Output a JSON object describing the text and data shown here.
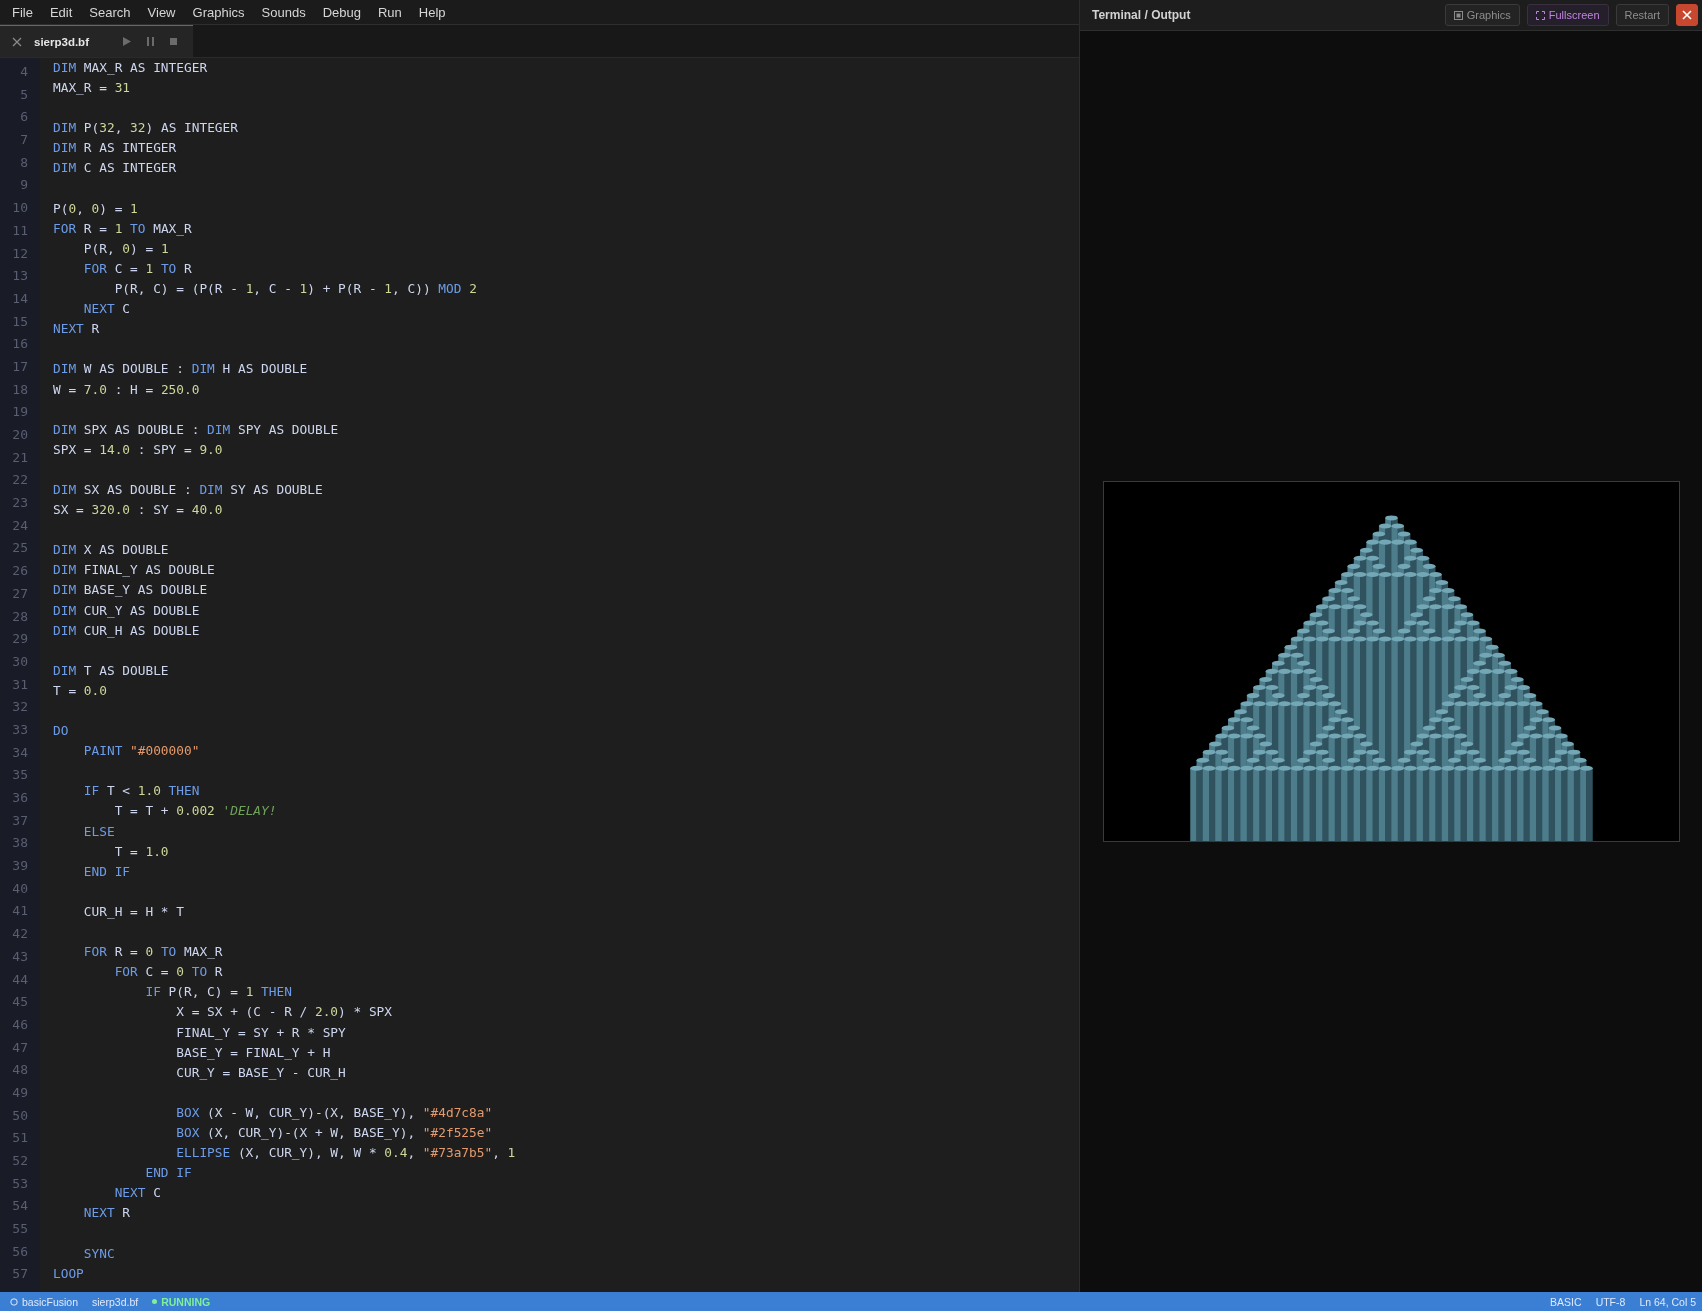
{
  "menu": [
    "File",
    "Edit",
    "Search",
    "View",
    "Graphics",
    "Sounds",
    "Debug",
    "Run",
    "Help"
  ],
  "tabs": [
    {
      "title": "sierp3d.bf",
      "selected": true
    }
  ],
  "line_numbers": [
    "4",
    "5",
    "6",
    "7",
    "8",
    "9",
    "10",
    "11",
    "12",
    "13",
    "14",
    "15",
    "16",
    "17",
    "18",
    "19",
    "20",
    "21",
    "22",
    "23",
    "24",
    "25",
    "26",
    "27",
    "28",
    "29",
    "30",
    "31",
    "32",
    "33",
    "34",
    "35",
    "36",
    "37",
    "38",
    "39",
    "40",
    "41",
    "42",
    "43",
    "44",
    "45",
    "46",
    "47",
    "48",
    "49",
    "50",
    "51",
    "52",
    "53",
    "54",
    "55",
    "56",
    "57"
  ],
  "code_blocks": [
    [
      [
        {
          "kind": "kw",
          "text": "DIM"
        },
        {
          "kind": "id",
          "text": " MAX_R AS INTEGER"
        }
      ],
      [
        {
          "kind": "id",
          "text": "MAX_R = "
        },
        {
          "kind": "num",
          "text": "31"
        }
      ]
    ],
    [
      [
        {
          "kind": "kw",
          "text": "DIM"
        },
        {
          "kind": "id",
          "text": " P("
        },
        {
          "kind": "num",
          "text": "32"
        },
        {
          "kind": "id",
          "text": ", "
        },
        {
          "kind": "num",
          "text": "32"
        },
        {
          "kind": "id",
          "text": ") AS INTEGER"
        }
      ],
      [
        {
          "kind": "kw",
          "text": "DIM"
        },
        {
          "kind": "id",
          "text": " R AS INTEGER"
        }
      ],
      [
        {
          "kind": "kw",
          "text": "DIM"
        },
        {
          "kind": "id",
          "text": " C AS INTEGER"
        }
      ]
    ],
    [
      [
        {
          "kind": "id",
          "text": "P("
        },
        {
          "kind": "num",
          "text": "0"
        },
        {
          "kind": "id",
          "text": ", "
        },
        {
          "kind": "num",
          "text": "0"
        },
        {
          "kind": "id",
          "text": ") = "
        },
        {
          "kind": "num",
          "text": "1"
        }
      ],
      [
        {
          "kind": "kw",
          "text": "FOR"
        },
        {
          "kind": "id",
          "text": " R = "
        },
        {
          "kind": "num",
          "text": "1"
        },
        {
          "kind": "kw",
          "text": " TO"
        },
        {
          "kind": "id",
          "text": " MAX_R"
        }
      ],
      [
        {
          "kind": "id",
          "text": "    P(R, "
        },
        {
          "kind": "num",
          "text": "0"
        },
        {
          "kind": "id",
          "text": ") = "
        },
        {
          "kind": "num",
          "text": "1"
        }
      ],
      [
        {
          "kind": "kw",
          "text": "    FOR"
        },
        {
          "kind": "id",
          "text": " C = "
        },
        {
          "kind": "num",
          "text": "1"
        },
        {
          "kind": "kw",
          "text": " TO"
        },
        {
          "kind": "id",
          "text": " R"
        }
      ],
      [
        {
          "kind": "id",
          "text": "        P(R, C) = (P(R - "
        },
        {
          "kind": "num",
          "text": "1"
        },
        {
          "kind": "id",
          "text": ", C - "
        },
        {
          "kind": "num",
          "text": "1"
        },
        {
          "kind": "id",
          "text": ") + P(R - "
        },
        {
          "kind": "num",
          "text": "1"
        },
        {
          "kind": "id",
          "text": ", C)) "
        },
        {
          "kind": "kw",
          "text": "MOD"
        },
        {
          "kind": "num",
          "text": " 2"
        }
      ],
      [
        {
          "kind": "kw",
          "text": "    NEXT"
        },
        {
          "kind": "id",
          "text": " C"
        }
      ],
      [
        {
          "kind": "kw",
          "text": "NEXT"
        },
        {
          "kind": "id",
          "text": " R"
        }
      ]
    ],
    [
      [
        {
          "kind": "kw",
          "text": "DIM"
        },
        {
          "kind": "id",
          "text": " W AS DOUBLE : "
        },
        {
          "kind": "kw",
          "text": "DIM"
        },
        {
          "kind": "id",
          "text": " H AS DOUBLE"
        }
      ],
      [
        {
          "kind": "id",
          "text": "W = "
        },
        {
          "kind": "num",
          "text": "7.0"
        },
        {
          "kind": "id",
          "text": " : H = "
        },
        {
          "kind": "num",
          "text": "250.0"
        }
      ]
    ],
    [
      [
        {
          "kind": "kw",
          "text": "DIM"
        },
        {
          "kind": "id",
          "text": " SPX AS DOUBLE : "
        },
        {
          "kind": "kw",
          "text": "DIM"
        },
        {
          "kind": "id",
          "text": " SPY AS DOUBLE"
        }
      ],
      [
        {
          "kind": "id",
          "text": "SPX = "
        },
        {
          "kind": "num",
          "text": "14.0"
        },
        {
          "kind": "id",
          "text": " : SPY = "
        },
        {
          "kind": "num",
          "text": "9.0"
        }
      ]
    ],
    [
      [
        {
          "kind": "kw",
          "text": "DIM"
        },
        {
          "kind": "id",
          "text": " SX AS DOUBLE : "
        },
        {
          "kind": "kw",
          "text": "DIM"
        },
        {
          "kind": "id",
          "text": " SY AS DOUBLE"
        }
      ],
      [
        {
          "kind": "id",
          "text": "SX = "
        },
        {
          "kind": "num",
          "text": "320.0"
        },
        {
          "kind": "id",
          "text": " : SY = "
        },
        {
          "kind": "num",
          "text": "40.0"
        }
      ]
    ],
    [
      [
        {
          "kind": "kw",
          "text": "DIM"
        },
        {
          "kind": "id",
          "text": " X AS DOUBLE"
        }
      ],
      [
        {
          "kind": "kw",
          "text": "DIM"
        },
        {
          "kind": "id",
          "text": " FINAL_Y AS DOUBLE"
        }
      ],
      [
        {
          "kind": "kw",
          "text": "DIM"
        },
        {
          "kind": "id",
          "text": " BASE_Y AS DOUBLE"
        }
      ],
      [
        {
          "kind": "kw",
          "text": "DIM"
        },
        {
          "kind": "id",
          "text": " CUR_Y AS DOUBLE"
        }
      ],
      [
        {
          "kind": "kw",
          "text": "DIM"
        },
        {
          "kind": "id",
          "text": " CUR_H AS DOUBLE"
        }
      ]
    ],
    [
      [
        {
          "kind": "kw",
          "text": "DIM"
        },
        {
          "kind": "id",
          "text": " T AS DOUBLE"
        }
      ],
      [
        {
          "kind": "id",
          "text": "T = "
        },
        {
          "kind": "num",
          "text": "0.0"
        }
      ]
    ],
    [
      [
        {
          "kind": "kw",
          "text": "DO"
        }
      ],
      [
        {
          "kind": "kw",
          "text": "    PAINT"
        },
        {
          "kind": "str",
          "text": " \"#000000\""
        }
      ]
    ],
    [
      [
        {
          "kind": "kw",
          "text": "    IF"
        },
        {
          "kind": "id",
          "text": " T < "
        },
        {
          "kind": "num",
          "text": "1.0"
        },
        {
          "kind": "kw",
          "text": " THEN"
        }
      ],
      [
        {
          "kind": "id",
          "text": "        T = T + "
        },
        {
          "kind": "num",
          "text": "0.002"
        },
        {
          "kind": "com",
          "text": " 'DELAY!"
        }
      ],
      [
        {
          "kind": "kw",
          "text": "    ELSE"
        }
      ],
      [
        {
          "kind": "id",
          "text": "        T = "
        },
        {
          "kind": "num",
          "text": "1.0"
        }
      ],
      [
        {
          "kind": "kw",
          "text": "    END IF"
        }
      ]
    ],
    [
      [
        {
          "kind": "id",
          "text": "    CUR_H = H * T"
        }
      ]
    ],
    [
      [
        {
          "kind": "kw",
          "text": "    FOR"
        },
        {
          "kind": "id",
          "text": " R = "
        },
        {
          "kind": "num",
          "text": "0"
        },
        {
          "kind": "kw",
          "text": " TO"
        },
        {
          "kind": "id",
          "text": " MAX_R"
        }
      ],
      [
        {
          "kind": "kw",
          "text": "        FOR"
        },
        {
          "kind": "id",
          "text": " C = "
        },
        {
          "kind": "num",
          "text": "0"
        },
        {
          "kind": "kw",
          "text": " TO"
        },
        {
          "kind": "id",
          "text": " R"
        }
      ],
      [
        {
          "kind": "kw",
          "text": "            IF"
        },
        {
          "kind": "id",
          "text": " P(R, C) = "
        },
        {
          "kind": "num",
          "text": "1"
        },
        {
          "kind": "kw",
          "text": " THEN"
        }
      ],
      [
        {
          "kind": "id",
          "text": "                X = SX + (C - R / "
        },
        {
          "kind": "num",
          "text": "2.0"
        },
        {
          "kind": "id",
          "text": ") * SPX"
        }
      ],
      [
        {
          "kind": "id",
          "text": "                FINAL_Y = SY + R * SPY"
        }
      ],
      [
        {
          "kind": "id",
          "text": "                BASE_Y = FINAL_Y + H"
        }
      ],
      [
        {
          "kind": "id",
          "text": "                CUR_Y = BASE_Y - CUR_H"
        }
      ]
    ],
    [
      [
        {
          "kind": "kw",
          "text": "                BOX"
        },
        {
          "kind": "id",
          "text": " (X - W, CUR_Y)-(X, BASE_Y), "
        },
        {
          "kind": "str",
          "text": "\"#4d7c8a\""
        }
      ],
      [
        {
          "kind": "kw",
          "text": "                BOX"
        },
        {
          "kind": "id",
          "text": " (X, CUR_Y)-(X + W, BASE_Y), "
        },
        {
          "kind": "str",
          "text": "\"#2f525e\""
        }
      ],
      [
        {
          "kind": "kw",
          "text": "                ELLIPSE"
        },
        {
          "kind": "id",
          "text": " (X, CUR_Y), W, W * "
        },
        {
          "kind": "num",
          "text": "0.4"
        },
        {
          "kind": "id",
          "text": ", "
        },
        {
          "kind": "str",
          "text": "\"#73a7b5\""
        },
        {
          "kind": "id",
          "text": ", "
        },
        {
          "kind": "num",
          "text": "1"
        }
      ],
      [
        {
          "kind": "kw",
          "text": "            END IF"
        }
      ],
      [
        {
          "kind": "kw",
          "text": "        NEXT"
        },
        {
          "kind": "id",
          "text": " C"
        }
      ],
      [
        {
          "kind": "kw",
          "text": "    NEXT"
        },
        {
          "kind": "id",
          "text": " R"
        }
      ]
    ],
    [
      [
        {
          "kind": "kw",
          "text": "    SYNC"
        }
      ],
      [
        {
          "kind": "kw",
          "text": "LOOP"
        }
      ]
    ]
  ],
  "output_panel": {
    "title": "Terminal / Output",
    "buttons": [
      {
        "kind": "graphics",
        "label": "Graphics"
      },
      {
        "kind": "fullscreen",
        "label": "Fullscreen"
      },
      {
        "kind": "restart",
        "label": "Restart"
      },
      {
        "kind": "close"
      }
    ]
  },
  "status_bar": {
    "left": [
      {
        "kind": "app",
        "text": "basicFusion"
      },
      {
        "kind": "file",
        "text": "sierp3d.bf"
      },
      {
        "kind": "running",
        "text": "RUNNING"
      }
    ],
    "right": [
      "BASIC",
      "UTF-8",
      "Ln 64, Col 5"
    ]
  }
}
